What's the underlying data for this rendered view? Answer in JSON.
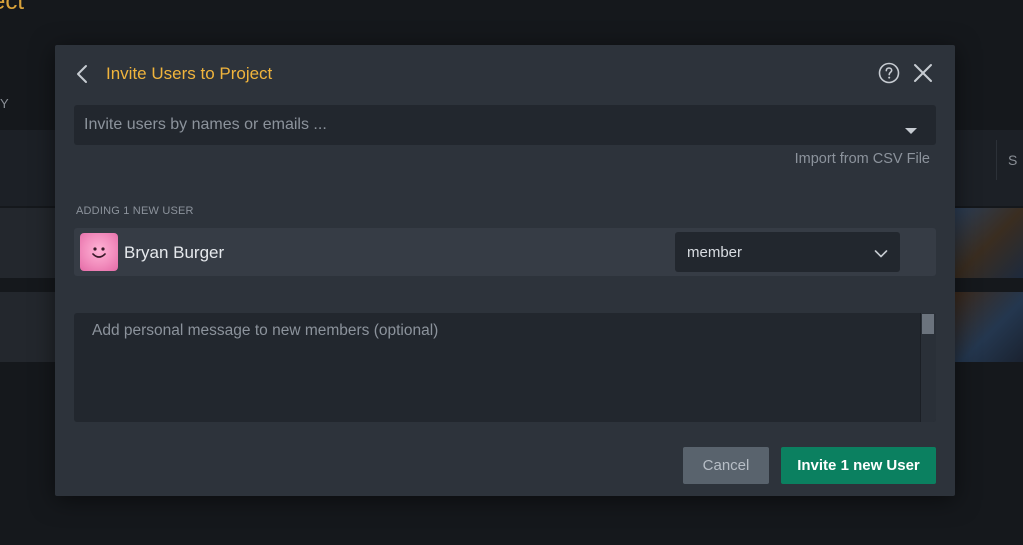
{
  "background": {
    "title_fragment": "ect",
    "side_letter": "Y",
    "right_letter": "S"
  },
  "modal": {
    "title": "Invite Users to Project",
    "icons": {
      "back": "chevron-left-icon",
      "help": "help-circle-icon",
      "close": "close-icon"
    },
    "invite_input": {
      "placeholder": "Invite users by names or emails ...",
      "value": ""
    },
    "import_csv_label": "Import from CSV File",
    "section_label": "ADDING 1 NEW USER",
    "users": [
      {
        "name": "Bryan Burger",
        "role": "member",
        "avatar": "smiley-avatar"
      }
    ],
    "message": {
      "placeholder": "Add personal message to new members (optional)",
      "value": ""
    },
    "cancel_label": "Cancel",
    "invite_label": "Invite 1 new User"
  },
  "colors": {
    "accent": "#f0b43c",
    "primary_button": "#0b8060",
    "secondary_button": "#59636d",
    "modal_bg": "#2d333b"
  }
}
